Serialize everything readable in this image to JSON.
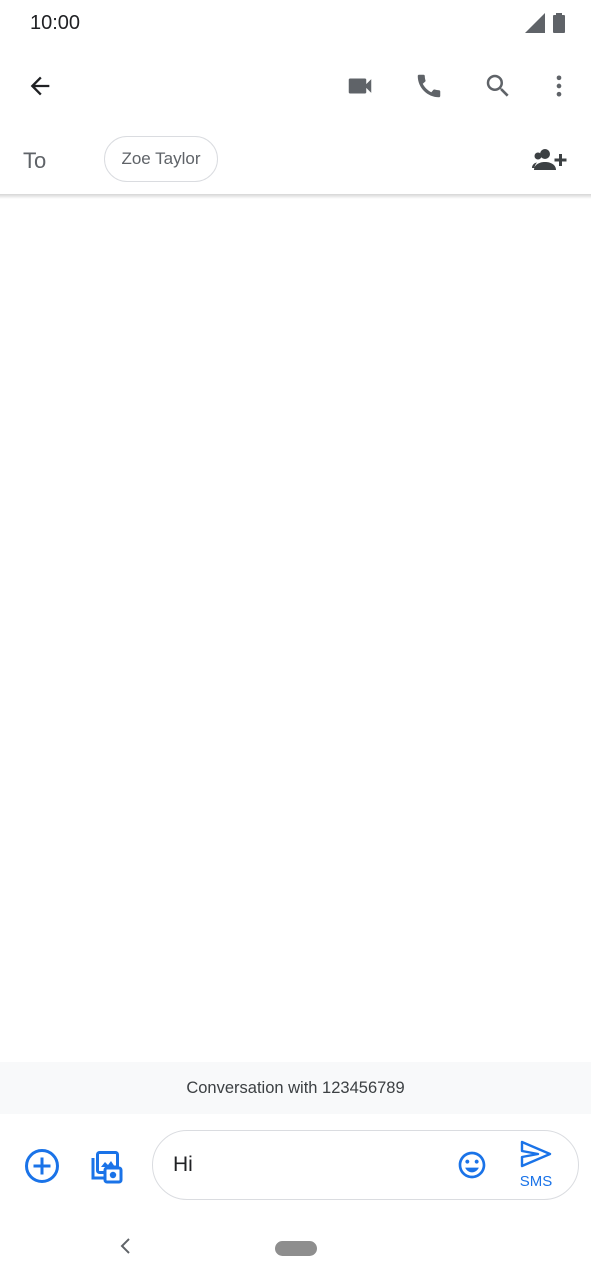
{
  "status_bar": {
    "time": "10:00"
  },
  "app_bar": {
    "icons": [
      "back-arrow-icon",
      "video-call-icon",
      "phone-icon",
      "search-icon",
      "more-vert-icon"
    ]
  },
  "recipients": {
    "to_label": "To",
    "chips": [
      "Zoe Taylor"
    ]
  },
  "conversation": {
    "banner": "Conversation with 123456789"
  },
  "compose": {
    "text": "Hi",
    "send_label": "SMS"
  },
  "colors": {
    "accent": "#1a73e8",
    "icon_grey": "#5f6368",
    "banner_bg": "#f8f9fa"
  }
}
